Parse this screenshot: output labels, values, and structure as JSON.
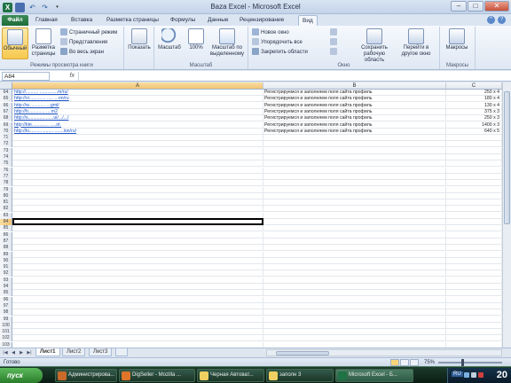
{
  "window": {
    "title": "Baza Excel - Microsoft Excel",
    "controls": [
      "–",
      "□",
      "✕"
    ]
  },
  "qat": {
    "app_icon": "X",
    "save_icon": "save-icon",
    "undo_icon": "undo-icon",
    "redo_icon": "redo-icon"
  },
  "ribbon_tabs": {
    "file": "Файл",
    "items": [
      "Главная",
      "Вставка",
      "Разметка страницы",
      "Формулы",
      "Данные",
      "Рецензирование",
      "Вид"
    ],
    "active": "Вид"
  },
  "ribbon": {
    "group_views": {
      "label": "Режимы просмотра книги",
      "normal": "Обычный",
      "page_layout": "Разметка страницы",
      "page_break": "Страничный режим",
      "custom_views": "Представления",
      "full_screen": "Во весь экран"
    },
    "group_show": {
      "label": "",
      "show": "Показать"
    },
    "group_zoom": {
      "label": "Масштаб",
      "zoom": "Масштаб",
      "zoom100": "100%",
      "zoom_selection": "Масштаб по выделенному"
    },
    "group_window": {
      "label": "Окно",
      "new_window": "Новое окно",
      "arrange_all": "Упорядочить все",
      "freeze_panes": "Закрепить области",
      "save_workspace": "Сохранить рабочую область",
      "switch_windows": "Перейти в другое окно"
    },
    "group_macros": {
      "label": "Макросы",
      "macros": "Макросы"
    }
  },
  "formula_bar": {
    "name_box": "A84",
    "fx": "fx",
    "value": ""
  },
  "columns": [
    {
      "name": "A"
    },
    {
      "name": "B"
    },
    {
      "name": "C"
    }
  ],
  "rows": [
    {
      "num": "64",
      "a": "http://..........  ..............m/ru/",
      "b": "Регистрируемся и заполняем поля сайта профиль",
      "c": "250 x 4"
    },
    {
      "num": "65",
      "a": "http://vi.............  .....  ...on/ru",
      "b": "Регистрируемся и заполняем поля сайта профиль",
      "c": "180 x 4"
    },
    {
      "num": "66",
      "a": "http://w.............  ...gml/",
      "b": "Регистрируемся и заполняем поля сайта профиль",
      "c": "130 x 4"
    },
    {
      "num": "67",
      "a": "http://h.............  ....m2",
      "b": "Регистрируемся и заполняем поля сайта профиль",
      "c": "375 x 3"
    },
    {
      "num": "68",
      "a": "http://s.............  ......ui/.../.../",
      "b": "Регистрируемся и заполняем поля сайта профиль",
      "c": "250 x 3"
    },
    {
      "num": "69",
      "a": "http://kte.............  .....ot.",
      "b": "Регистрируемся и заполняем поля сайта профиль",
      "c": "1400 x 3"
    },
    {
      "num": "70",
      "a": "http://ki..........  ........  .......ion/ru/",
      "b": "Регистрируемся и заполняем поля сайта профиль",
      "c": "640 x 5"
    },
    {
      "num": "71",
      "a": "",
      "b": "",
      "c": ""
    },
    {
      "num": "72",
      "a": "",
      "b": "",
      "c": ""
    },
    {
      "num": "73",
      "a": "",
      "b": "",
      "c": ""
    },
    {
      "num": "74",
      "a": "",
      "b": "",
      "c": ""
    },
    {
      "num": "75",
      "a": "",
      "b": "",
      "c": ""
    },
    {
      "num": "76",
      "a": "",
      "b": "",
      "c": ""
    },
    {
      "num": "77",
      "a": "",
      "b": "",
      "c": ""
    },
    {
      "num": "78",
      "a": "",
      "b": "",
      "c": ""
    },
    {
      "num": "79",
      "a": "",
      "b": "",
      "c": ""
    },
    {
      "num": "80",
      "a": "",
      "b": "",
      "c": ""
    },
    {
      "num": "81",
      "a": "",
      "b": "",
      "c": ""
    },
    {
      "num": "82",
      "a": "",
      "b": "",
      "c": ""
    },
    {
      "num": "83",
      "a": "",
      "b": "",
      "c": ""
    },
    {
      "num": "84",
      "a": "",
      "b": "",
      "c": ""
    },
    {
      "num": "85",
      "a": "",
      "b": "",
      "c": ""
    },
    {
      "num": "86",
      "a": "",
      "b": "",
      "c": ""
    },
    {
      "num": "87",
      "a": "",
      "b": "",
      "c": ""
    },
    {
      "num": "88",
      "a": "",
      "b": "",
      "c": ""
    },
    {
      "num": "89",
      "a": "",
      "b": "",
      "c": ""
    },
    {
      "num": "90",
      "a": "",
      "b": "",
      "c": ""
    },
    {
      "num": "91",
      "a": "",
      "b": "",
      "c": ""
    },
    {
      "num": "92",
      "a": "",
      "b": "",
      "c": ""
    },
    {
      "num": "93",
      "a": "",
      "b": "",
      "c": ""
    },
    {
      "num": "94",
      "a": "",
      "b": "",
      "c": ""
    },
    {
      "num": "95",
      "a": "",
      "b": "",
      "c": ""
    },
    {
      "num": "96",
      "a": "",
      "b": "",
      "c": ""
    },
    {
      "num": "97",
      "a": "",
      "b": "",
      "c": ""
    },
    {
      "num": "98",
      "a": "",
      "b": "",
      "c": ""
    },
    {
      "num": "99",
      "a": "",
      "b": "",
      "c": ""
    },
    {
      "num": "100",
      "a": "",
      "b": "",
      "c": ""
    },
    {
      "num": "101",
      "a": "",
      "b": "",
      "c": ""
    },
    {
      "num": "102",
      "a": "",
      "b": "",
      "c": ""
    },
    {
      "num": "103",
      "a": "",
      "b": "",
      "c": ""
    }
  ],
  "active_row": "84",
  "sheets": {
    "tabs": [
      "Лист1",
      "Лист2",
      "Лист3"
    ],
    "active": "Лист1",
    "nav": [
      "|◀",
      "◀",
      "▶",
      "▶|"
    ]
  },
  "status": {
    "ready": "Готово",
    "zoom_percent": "75%",
    "zoom_level": 0.75
  },
  "taskbar": {
    "start": "пуск",
    "tasks": [
      {
        "label": "Администрирова...",
        "active": false,
        "color": "#c96a2a"
      },
      {
        "label": "DigSeller - Mozilla ...",
        "active": false,
        "color": "#e0752a"
      },
      {
        "label": "Черная Автоват...",
        "active": false,
        "color": "#f0d060"
      },
      {
        "label": "заполн 3",
        "active": false,
        "color": "#f0d060"
      },
      {
        "label": "Microsoft Excel - Б...",
        "active": true,
        "color": "#1f7244"
      }
    ],
    "lang": "RU",
    "clock": "20"
  },
  "colors": {
    "excel_green": "#1f7244",
    "link_blue": "#1f56c9",
    "selection_orange": "#f0c374"
  }
}
